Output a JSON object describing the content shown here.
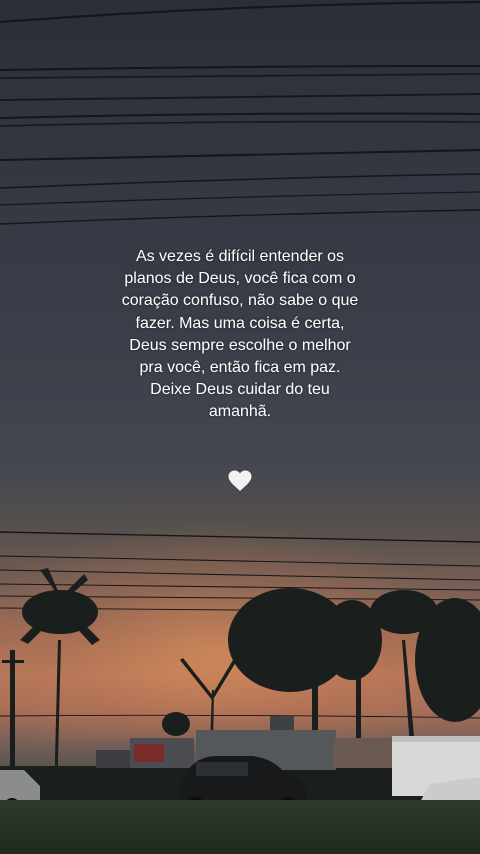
{
  "quote": {
    "lines": [
      "As vezes é difícil entender os",
      "planos de Deus, você fica com o",
      "coração confuso, não sabe o que",
      "fazer. Mas uma coisa é certa,",
      "Deus sempre escolhe o melhor",
      "pra você, então fica em paz.",
      "Deixe Deus cuidar do teu",
      "amanhã."
    ]
  },
  "heart": {
    "icon": "white-heart-icon",
    "color": "#f2f2f2"
  },
  "colors": {
    "sky_top": "#2a2f37",
    "sunset": "#b5785a",
    "text": "#ffffff"
  }
}
